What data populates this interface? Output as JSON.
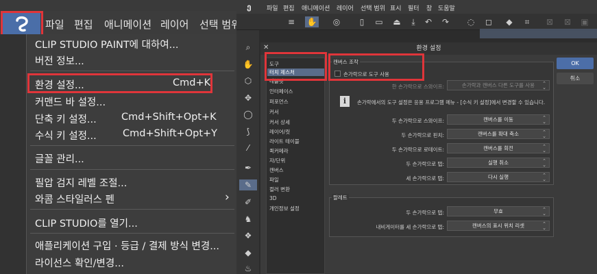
{
  "left": {
    "menubar": [
      "파일",
      "편집",
      "애니메이션",
      "레이어",
      "선택 범위"
    ],
    "menu": {
      "about": "CLIP STUDIO PAINT에 대하여...",
      "version": "버전 정보...",
      "preferences": "환경 설정...",
      "preferences_shortcut": "Cmd+K",
      "command_bar": "커맨드 바 설정...",
      "shortcut_settings": "단축 키 설정...",
      "shortcut_settings_shortcut": "Cmd+Shift+Opt+K",
      "modifier_settings": "수식 키 설정...",
      "modifier_settings_shortcut": "Cmd+Shift+Opt+Y",
      "font_management": "글꼴 관리...",
      "pressure": "필압 검지 레벨 조절...",
      "wacom": "와콤 스타일러스 펜",
      "wacom_arrow": "›",
      "open_clip_studio": "CLIP STUDIO를 열기...",
      "purchase": "애플리케이션 구입 · 등급 / 결제 방식 변경...",
      "license": "라이선스 확인/변경..."
    }
  },
  "right": {
    "menubar": [
      "파일",
      "편집",
      "애니메이션",
      "레이어",
      "선택 범위",
      "표시",
      "필터",
      "창",
      "도움말"
    ],
    "dialog": {
      "title": "환경 설정",
      "close": "✕",
      "categories": [
        "도구",
        "터치 제스처",
        "태블릿",
        "인터페이스",
        "퍼포먼스",
        "커서",
        "커서 상세",
        "레이어/컷",
        "라이트 테이블",
        "퀵커메라",
        "자/단위",
        "캔버스",
        "파일",
        "컬러 변환",
        "3D",
        "개인정보 설정"
      ],
      "selected_category": "터치 제스처",
      "canvas_section": "캔버스 조작",
      "use_finger_tool": "손가락으로 도구 사용",
      "one_finger_swipe_label": "한 손가락으로 스와이프:",
      "one_finger_swipe_value": "손가락과 캔버스 다른 도구를 사용",
      "info_text": "손가락에서의 도구 설정은 응용 프로그램 메뉴 - [수식 키 설정]에서 변경할 수 있습니다.",
      "rows": [
        {
          "label": "두 손가락으로 스와이프:",
          "value": "캔버스를 이동"
        },
        {
          "label": "두 손가락으로 핀치:",
          "value": "캔버스를 확대 축소"
        },
        {
          "label": "두 손가락으로 로테이트:",
          "value": "캔버스를 회전"
        },
        {
          "label": "두 손가락으로 탭:",
          "value": "실행 취소"
        },
        {
          "label": "세 손가락으로 탭:",
          "value": "다시 실행"
        }
      ],
      "palette_section": "팔레트",
      "palette_rows": [
        {
          "label": "두 손가락으로 탭:",
          "value": "무효"
        },
        {
          "label": "내비게이터를 세 손가락으로 탭:",
          "value": "캔버스의 표시 위치 리셋"
        }
      ],
      "ok": "OK",
      "cancel": "취소"
    }
  },
  "colors": {
    "highlight": "#e0353a",
    "accent": "#4c6ea8"
  }
}
